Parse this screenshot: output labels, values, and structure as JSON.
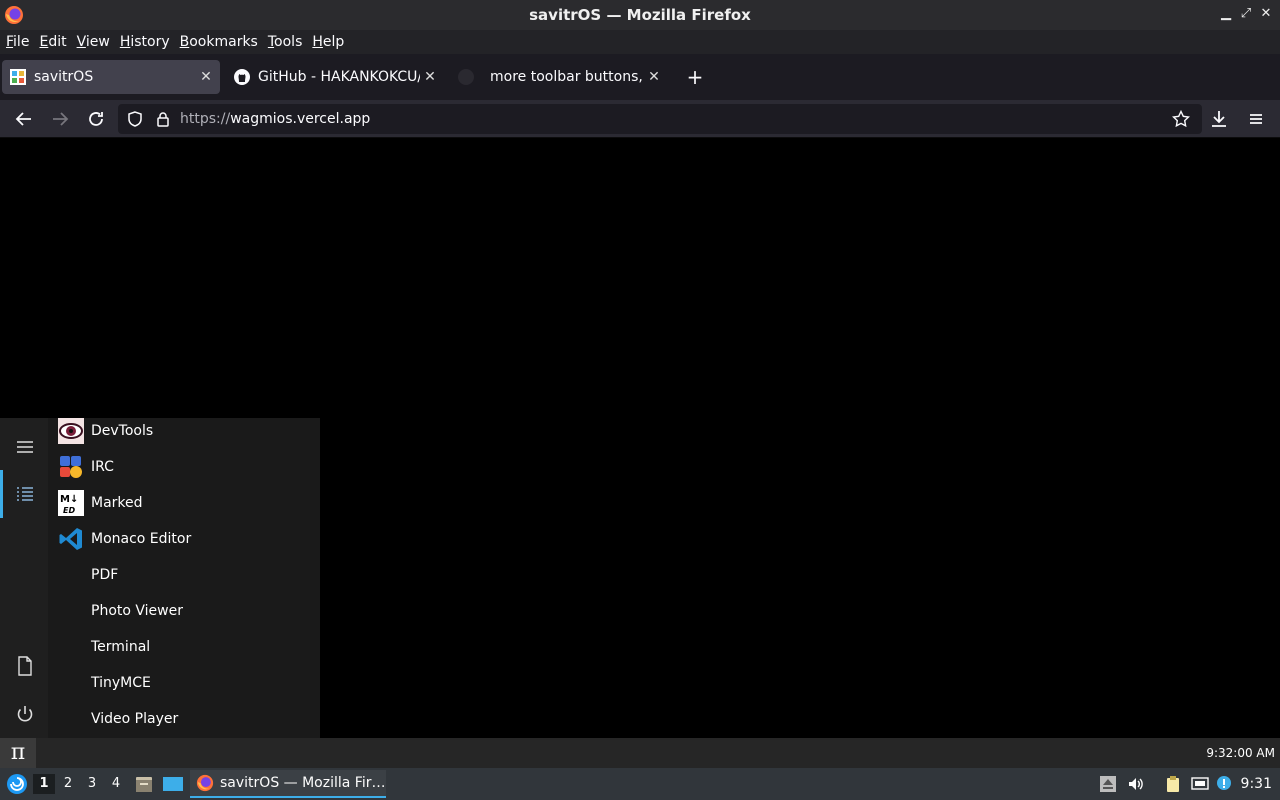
{
  "window": {
    "title": "savitrOS — Mozilla Firefox"
  },
  "menubar": {
    "items": [
      {
        "label": "File",
        "key": "F",
        "rest": "ile"
      },
      {
        "label": "Edit",
        "key": "E",
        "rest": "dit"
      },
      {
        "label": "View",
        "key": "V",
        "rest": "iew"
      },
      {
        "label": "History",
        "key": "H",
        "rest": "istory"
      },
      {
        "label": "Bookmarks",
        "key": "B",
        "rest": "ookmarks"
      },
      {
        "label": "Tools",
        "key": "T",
        "rest": "ools"
      },
      {
        "label": "Help",
        "key": "H",
        "rest": "elp"
      }
    ]
  },
  "tabs": [
    {
      "label": "savitrOS",
      "icon": "savitros-favicon",
      "active": true
    },
    {
      "label": "GitHub - HAKANKOKCU/B",
      "icon": "github-icon",
      "active": false
    },
    {
      "label": "more toolbar buttons, ed",
      "icon": "github-icon",
      "active": false
    }
  ],
  "navbar": {
    "url_proto": "https://",
    "url_host": "wagmios.vercel.app"
  },
  "startmenu": {
    "apps": [
      {
        "label": "DevTools",
        "icon": "devtools-eye-icon"
      },
      {
        "label": "IRC",
        "icon": "irc-icon"
      },
      {
        "label": "Marked",
        "icon": "markdown-icon"
      },
      {
        "label": "Monaco Editor",
        "icon": "vscode-icon"
      },
      {
        "label": "PDF",
        "icon": ""
      },
      {
        "label": "Photo Viewer",
        "icon": ""
      },
      {
        "label": "Terminal",
        "icon": ""
      },
      {
        "label": "TinyMCE",
        "icon": ""
      },
      {
        "label": "Video Player",
        "icon": ""
      }
    ],
    "accent": "#3daee9"
  },
  "pibar": {
    "pi_label": "π",
    "clock": "9:32:00 AM"
  },
  "taskbar": {
    "workspaces": [
      "1",
      "2",
      "3",
      "4"
    ],
    "active_workspace": "1",
    "app_label": "savitrOS — Mozilla Fir…",
    "clock": "9:31"
  }
}
